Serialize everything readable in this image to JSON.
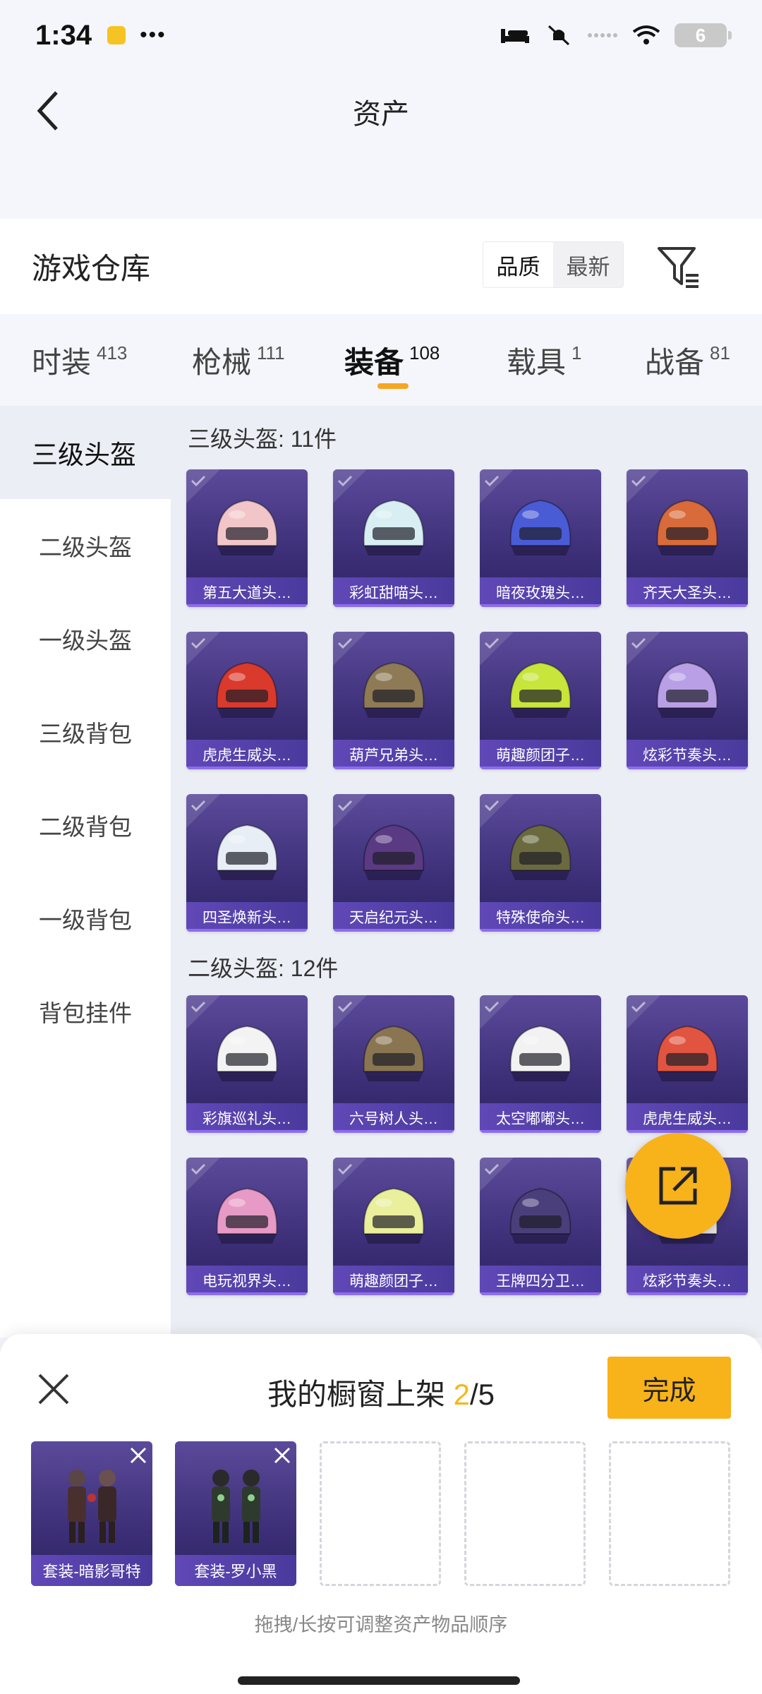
{
  "status_bar": {
    "time": "1:34",
    "dots": "•••",
    "battery": "6"
  },
  "header": {
    "title": "资产"
  },
  "warehouse": {
    "title": "游戏仓库",
    "sort_options": [
      "品质",
      "最新"
    ]
  },
  "tabs": [
    {
      "label": "时装",
      "count": "413"
    },
    {
      "label": "枪械",
      "count": "111"
    },
    {
      "label": "装备",
      "count": "108"
    },
    {
      "label": "载具",
      "count": "1"
    },
    {
      "label": "战备",
      "count": "81"
    }
  ],
  "sidebar": {
    "items": [
      "三级头盔",
      "二级头盔",
      "一级头盔",
      "三级背包",
      "二级背包",
      "一级背包",
      "背包挂件"
    ]
  },
  "sections": [
    {
      "title": "三级头盔: 11件",
      "items": [
        {
          "name": "第五大道头…",
          "color": "#f2c6c9"
        },
        {
          "name": "彩虹甜喵头…",
          "color": "#d8eef2"
        },
        {
          "name": "暗夜玫瑰头…",
          "color": "#4a5bd6"
        },
        {
          "name": "齐天大圣头…",
          "color": "#d96a3a"
        },
        {
          "name": "虎虎生威头…",
          "color": "#d93a2c"
        },
        {
          "name": "葫芦兄弟头…",
          "color": "#8e7a55"
        },
        {
          "name": "萌趣颜团子…",
          "color": "#c7e53a"
        },
        {
          "name": "炫彩节奏头…",
          "color": "#b9a0e6"
        },
        {
          "name": "四圣焕新头…",
          "color": "#e8eef6"
        },
        {
          "name": "天启纪元头…",
          "color": "#5b3a84"
        },
        {
          "name": "特殊使命头…",
          "color": "#6b6a3f"
        }
      ]
    },
    {
      "title": "二级头盔: 12件",
      "items": [
        {
          "name": "彩旗巡礼头…",
          "color": "#f3f3f3"
        },
        {
          "name": "六号树人头…",
          "color": "#8a7552"
        },
        {
          "name": "太空嘟嘟头…",
          "color": "#f2f2f2"
        },
        {
          "name": "虎虎生威头…",
          "color": "#e05440"
        },
        {
          "name": "电玩视界头…",
          "color": "#e69ac5"
        },
        {
          "name": "萌趣颜团子…",
          "color": "#e9ef9a"
        },
        {
          "name": "王牌四分卫…",
          "color": "#4a3f7a"
        },
        {
          "name": "炫彩节奏头…",
          "color": "#e8e8e8"
        }
      ]
    }
  ],
  "showcase": {
    "title_prefix": "我的橱窗上架",
    "current": "2",
    "total": "/5",
    "done_label": "完成",
    "slots": [
      {
        "name": "套装-暗影哥特",
        "color": "#3a2a2a"
      },
      {
        "name": "套装-罗小黑",
        "color": "#2f3a2f"
      }
    ],
    "hint": "拖拽/长按可调整资产物品顺序"
  }
}
